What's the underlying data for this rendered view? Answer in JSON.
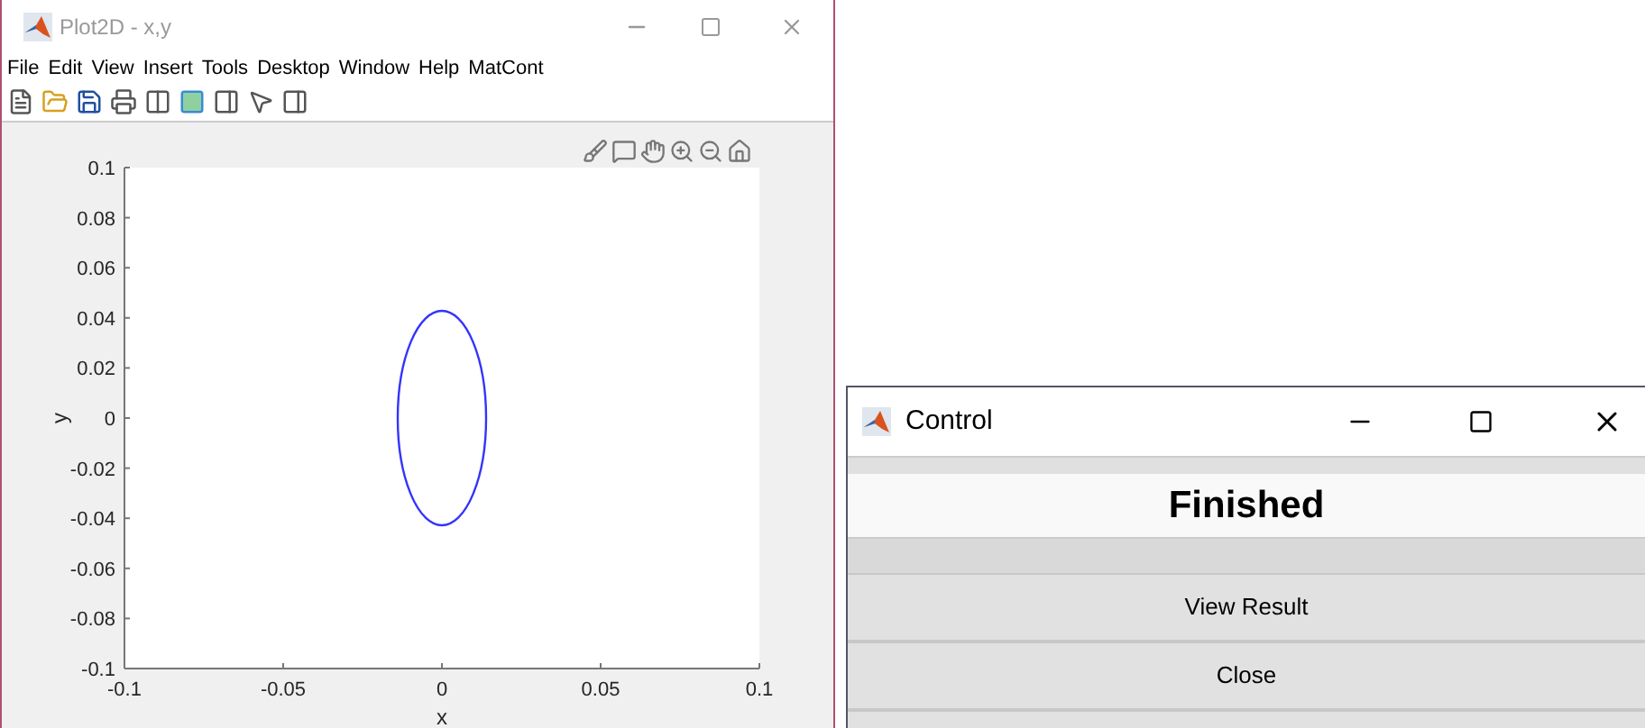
{
  "plot_window": {
    "title": "Plot2D - x,y",
    "menu": [
      "File",
      "Edit",
      "View",
      "Insert",
      "Tools",
      "Desktop",
      "Window",
      "Help",
      "MatCont"
    ],
    "chart_data": {
      "type": "line",
      "xlabel": "x",
      "ylabel": "y",
      "xlim": [
        -0.1,
        0.1
      ],
      "ylim": [
        -0.1,
        0.1
      ],
      "xticks": [
        {
          "value": -0.1,
          "label": "-0.1"
        },
        {
          "value": -0.05,
          "label": "-0.05"
        },
        {
          "value": 0,
          "label": "0"
        },
        {
          "value": 0.05,
          "label": "0.05"
        },
        {
          "value": 0.1,
          "label": "0.1"
        }
      ],
      "yticks": [
        {
          "value": -0.1,
          "label": "-0.1"
        },
        {
          "value": -0.08,
          "label": "-0.08"
        },
        {
          "value": -0.06,
          "label": "-0.06"
        },
        {
          "value": -0.04,
          "label": "-0.04"
        },
        {
          "value": -0.02,
          "label": "-0.02"
        },
        {
          "value": 0,
          "label": "0"
        },
        {
          "value": 0.02,
          "label": "0.02"
        },
        {
          "value": 0.04,
          "label": "0.04"
        },
        {
          "value": 0.06,
          "label": "0.06"
        },
        {
          "value": 0.08,
          "label": "0.08"
        },
        {
          "value": 0.1,
          "label": "0.1"
        }
      ]
    }
  },
  "control_window": {
    "title": "Control",
    "status": "Finished",
    "buttons": [
      "View Result",
      "Close"
    ]
  }
}
